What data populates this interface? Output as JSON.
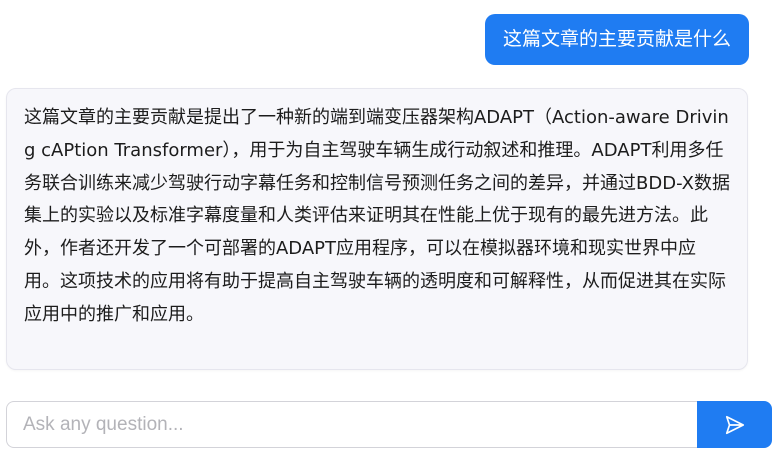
{
  "conversation": {
    "user_message": "这篇文章的主要贡献是什么",
    "assistant_message": "这篇文章的主要贡献是提出了一种新的端到端变压器架构ADAPT（Action-aware Driving cAPtion Transformer），用于为自主驾驶车辆生成行动叙述和推理。ADAPT利用多任务联合训练来减少驾驶行动字幕任务和控制信号预测任务之间的差异，并通过BDD-X数据集上的实验以及标准字幕度量和人类评估来证明其在性能上优于现有的最先进方法。此外，作者还开发了一个可部署的ADAPT应用程序，可以在模拟器环境和现实世界中应用。这项技术的应用将有助于提高自主驾驶车辆的透明度和可解释性，从而促进其在实际应用中的推广和应用。"
  },
  "composer": {
    "placeholder": "Ask any question...",
    "value": "",
    "send_icon": "send-icon"
  },
  "colors": {
    "accent": "#1f7cf2",
    "assistant_bubble_bg": "#f7f7fb",
    "placeholder_text": "#b3b3b8"
  }
}
